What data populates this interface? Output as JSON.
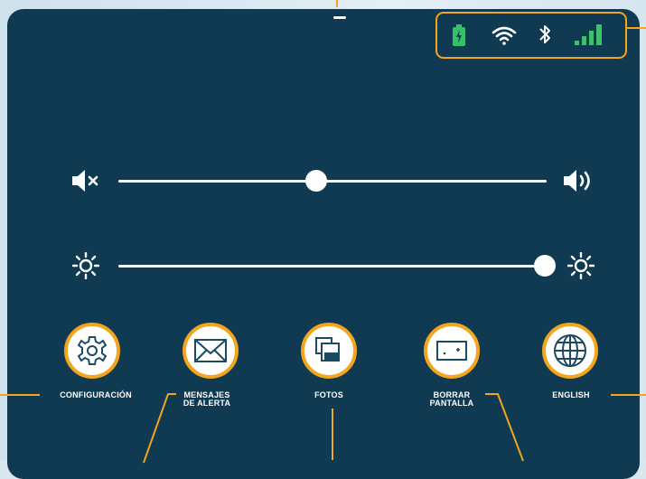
{
  "colors": {
    "panel": "#0f3a52",
    "accent": "#f3a51c",
    "icon_dark": "#1b4a63",
    "battery_green": "#37c06a",
    "signal_green": "#3cc26b"
  },
  "status_bar": {
    "icons": [
      "battery-charging-icon",
      "wifi-icon",
      "bluetooth-icon",
      "signal-icon"
    ]
  },
  "volume": {
    "level": 0.36
  },
  "brightness": {
    "level": 1.0
  },
  "buttons": [
    {
      "icon": "gear-icon",
      "label": "CONFIGURACIÓN"
    },
    {
      "icon": "envelope-icon",
      "label": "MENSAJES\nDE ALERTA"
    },
    {
      "icon": "photos-icon",
      "label": "FOTOS"
    },
    {
      "icon": "clear-screen-icon",
      "label": "BORRAR\nPANTALLA"
    },
    {
      "icon": "globe-icon",
      "label": "ENGLISH"
    }
  ]
}
